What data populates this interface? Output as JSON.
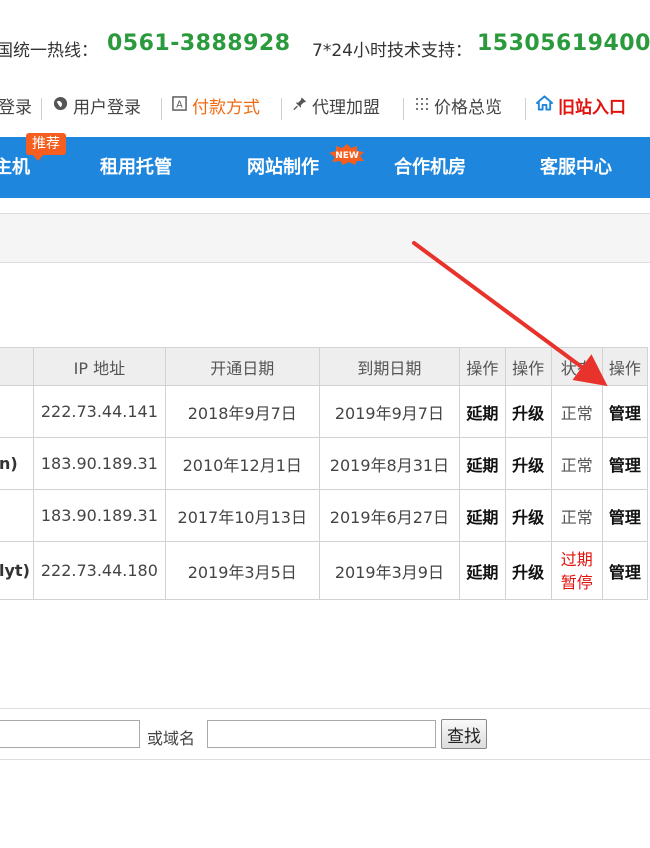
{
  "header": {
    "hotline_label": "国统一热线：",
    "hotline_number": "0561-3888928",
    "support_label": "7*24小时技术支持：",
    "support_number": "15305619400"
  },
  "toplinks": [
    {
      "label": "登录",
      "icon": "none"
    },
    {
      "label": "用户登录",
      "icon": "globe-icon"
    },
    {
      "label": "付款方式",
      "icon": "payment-icon"
    },
    {
      "label": "代理加盟",
      "icon": "pin-icon"
    },
    {
      "label": "价格总览",
      "icon": "grid-icon"
    },
    {
      "label": "旧站入口",
      "icon": "home-icon"
    }
  ],
  "nav": {
    "items": [
      "主机",
      "租用托管",
      "网站制作",
      "合作机房",
      "客服中心"
    ],
    "badge_recommend": "推荐",
    "badge_new": "NEW"
  },
  "table": {
    "headers": [
      "",
      "IP 地址",
      "开通日期",
      "到期日期",
      "操作",
      "操作",
      "状态",
      "操作"
    ],
    "rows": [
      {
        "name": "",
        "ip": "222.73.44.141",
        "open": "2018年9月7日",
        "expire": "2019年9月7日",
        "act1": "延期",
        "act2": "升级",
        "status": "正常",
        "status2": "",
        "manage": "管理"
      },
      {
        "name": "n)",
        "ip": "183.90.189.31",
        "open": "2010年12月1日",
        "expire": "2019年8月31日",
        "act1": "延期",
        "act2": "升级",
        "status": "正常",
        "status2": "",
        "manage": "管理"
      },
      {
        "name": "",
        "ip": "183.90.189.31",
        "open": "2017年10月13日",
        "expire": "2019年6月27日",
        "act1": "延期",
        "act2": "升级",
        "status": "正常",
        "status2": "",
        "manage": "管理"
      },
      {
        "name": "lyt)",
        "ip": "222.73.44.180",
        "open": "2019年3月5日",
        "expire": "2019年3月9日",
        "act1": "延期",
        "act2": "升级",
        "status": "过期",
        "status2": "暂停",
        "manage": "管理"
      }
    ]
  },
  "search": {
    "or_domain_label": "或域名",
    "find_button": "查找"
  },
  "colors": {
    "nav_blue": "#1e86dc",
    "hotline_green": "#2a9a3c",
    "accent_orange": "#f26a0e",
    "alert_red": "#e0140f",
    "arrow_red": "#e8332c"
  }
}
